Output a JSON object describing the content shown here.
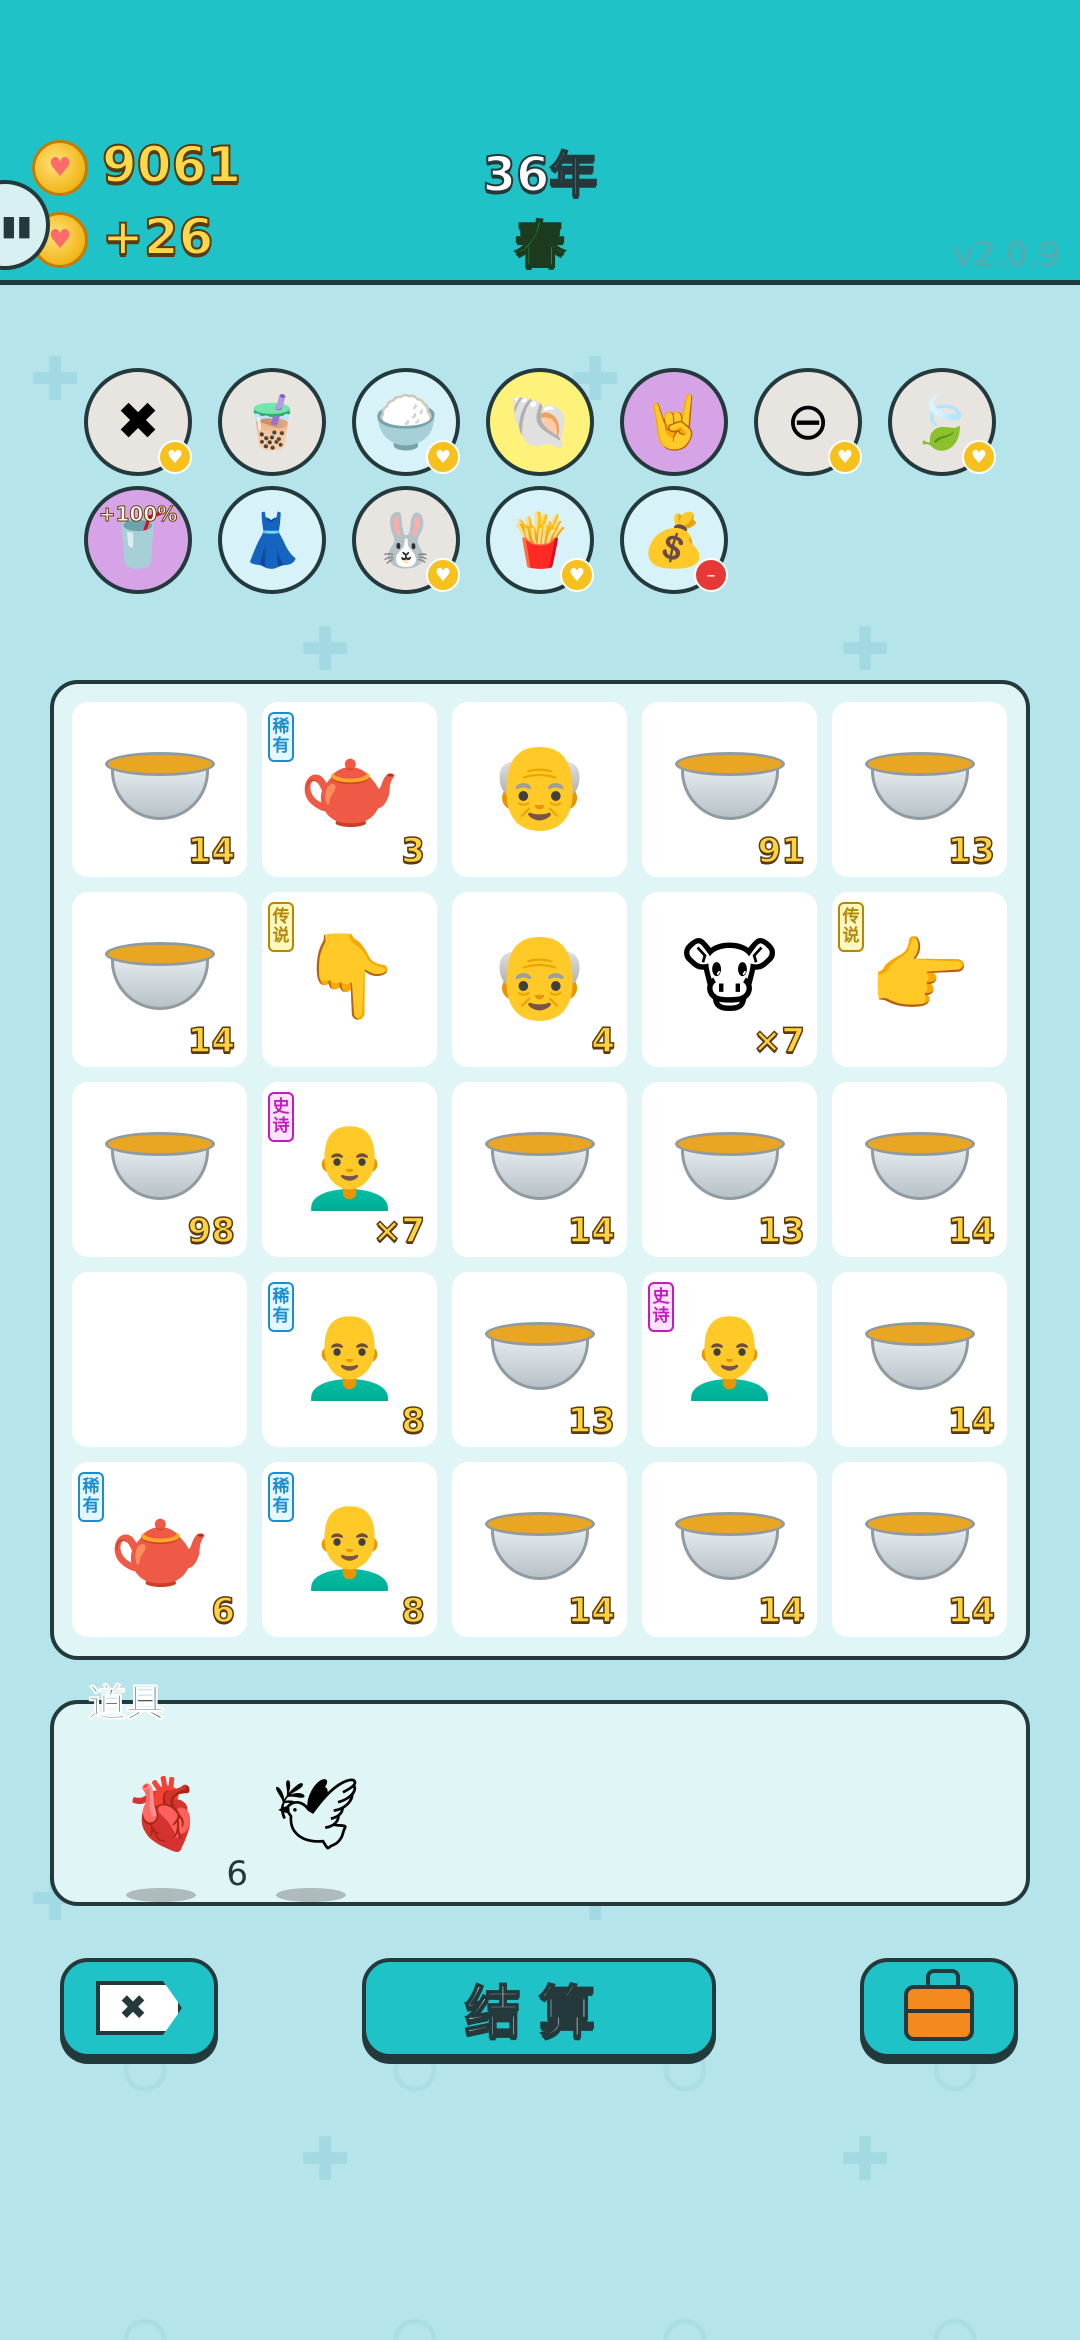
{
  "header": {
    "coins": "9061",
    "income": "+26",
    "year": "36年",
    "season": "春",
    "version": "v2.0.9"
  },
  "buffs": [
    {
      "name": "discard-tag-icon",
      "bg": "#e8e4e0",
      "glyph": "✖",
      "badge": "coin"
    },
    {
      "name": "bubble-tea-lid-icon",
      "bg": "#e8e4e0",
      "glyph": "🧋",
      "badge": ""
    },
    {
      "name": "rice-bowl-icon",
      "bg": "#d8f2fa",
      "glyph": "🍚",
      "badge": "coin"
    },
    {
      "name": "shell-icon",
      "bg": "#fff27a",
      "glyph": "🐚",
      "badge": ""
    },
    {
      "name": "rock-hand-icon",
      "bg": "#d6a4e6",
      "glyph": "🤘",
      "badge": ""
    },
    {
      "name": "minus-circle-icon",
      "bg": "#e8e4e0",
      "glyph": "⊖",
      "badge": "coin"
    },
    {
      "name": "leaf-icon",
      "bg": "#e8e4e0",
      "glyph": "🍃",
      "badge": "coin"
    },
    {
      "name": "milk-tea-boost-icon",
      "bg": "#d6a4e6",
      "glyph": "🥤",
      "badge": "",
      "text": "+100%"
    },
    {
      "name": "skirt-icon",
      "bg": "#d8f2fa",
      "glyph": "👗",
      "badge": ""
    },
    {
      "name": "rabbit-icon",
      "bg": "#e8e4e0",
      "glyph": "🐰",
      "badge": "coin"
    },
    {
      "name": "fries-icon",
      "bg": "#d8f2fa",
      "glyph": "🍟",
      "badge": "coin"
    },
    {
      "name": "sack-icon",
      "bg": "#d8f2fa",
      "glyph": "💰",
      "badge": "red"
    }
  ],
  "grid": [
    {
      "item": "bowl",
      "count": "14",
      "tag": ""
    },
    {
      "item": "teapot",
      "count": "3",
      "tag": "稀有"
    },
    {
      "item": "old-man-face",
      "count": "",
      "tag": ""
    },
    {
      "item": "bowl",
      "count": "91",
      "tag": ""
    },
    {
      "item": "bowl",
      "count": "13",
      "tag": ""
    },
    {
      "item": "bowl",
      "count": "14",
      "tag": ""
    },
    {
      "item": "pointing-hand-down",
      "count": "",
      "tag": "传说"
    },
    {
      "item": "old-man-face",
      "count": "4",
      "tag": ""
    },
    {
      "item": "cow-figure",
      "count": "×7",
      "tag": ""
    },
    {
      "item": "pointing-hand-right",
      "count": "",
      "tag": "传说"
    },
    {
      "item": "bowl",
      "count": "98",
      "tag": ""
    },
    {
      "item": "grumpy-bald-man",
      "count": "×7",
      "tag": "史诗"
    },
    {
      "item": "bowl",
      "count": "14",
      "tag": ""
    },
    {
      "item": "bowl",
      "count": "13",
      "tag": ""
    },
    {
      "item": "bowl",
      "count": "14",
      "tag": ""
    },
    {
      "item": "empty",
      "count": "",
      "tag": ""
    },
    {
      "item": "bald-man",
      "count": "8",
      "tag": "稀有"
    },
    {
      "item": "bowl",
      "count": "13",
      "tag": ""
    },
    {
      "item": "grumpy-bald-man",
      "count": "",
      "tag": "史诗"
    },
    {
      "item": "bowl",
      "count": "14",
      "tag": ""
    },
    {
      "item": "teapot",
      "count": "6",
      "tag": "稀有"
    },
    {
      "item": "bald-man",
      "count": "8",
      "tag": "稀有"
    },
    {
      "item": "bowl",
      "count": "14",
      "tag": ""
    },
    {
      "item": "bowl",
      "count": "14",
      "tag": ""
    },
    {
      "item": "bowl",
      "count": "14",
      "tag": ""
    }
  ],
  "items_panel": {
    "label": "道具",
    "items": [
      {
        "name": "liver-item-icon",
        "glyph": "🫀",
        "count": "6"
      },
      {
        "name": "bird-item-icon",
        "glyph": "🕊",
        "count": ""
      }
    ]
  },
  "buttons": {
    "settle_label": "结算"
  }
}
